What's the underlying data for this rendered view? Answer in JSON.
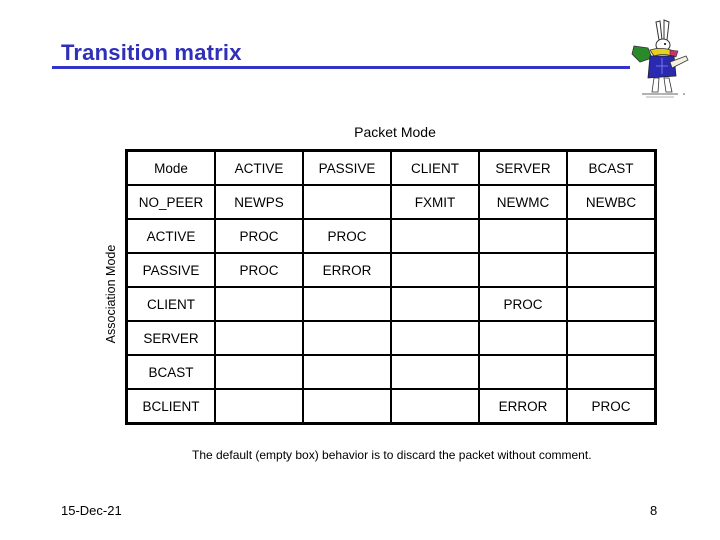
{
  "slide": {
    "title": "Transition matrix",
    "logo_icon": "white-rabbit-illustration",
    "accent_color": "#3333cc"
  },
  "matrix": {
    "column_axis_label": "Packet Mode",
    "row_axis_label": "Association Mode",
    "header": [
      "Mode",
      "ACTIVE",
      "PASSIVE",
      "CLIENT",
      "SERVER",
      "BCAST"
    ],
    "rows": [
      {
        "mode": "NO_PEER",
        "cells": [
          "NEWPS",
          "",
          "FXMIT",
          "NEWMC",
          "NEWBC"
        ]
      },
      {
        "mode": "ACTIVE",
        "cells": [
          "PROC",
          "PROC",
          "",
          "",
          ""
        ]
      },
      {
        "mode": "PASSIVE",
        "cells": [
          "PROC",
          "ERROR",
          "",
          "",
          ""
        ]
      },
      {
        "mode": "CLIENT",
        "cells": [
          "",
          "",
          "",
          "PROC",
          ""
        ]
      },
      {
        "mode": "SERVER",
        "cells": [
          "",
          "",
          "",
          "",
          ""
        ]
      },
      {
        "mode": "BCAST",
        "cells": [
          "",
          "",
          "",
          "",
          ""
        ]
      },
      {
        "mode": "BCLIENT",
        "cells": [
          "",
          "",
          "",
          "ERROR",
          "PROC"
        ]
      }
    ]
  },
  "footnote": "The default (empty box) behavior is to discard the packet without comment.",
  "footer": {
    "date": "15-Dec-21",
    "page_number": "8"
  }
}
